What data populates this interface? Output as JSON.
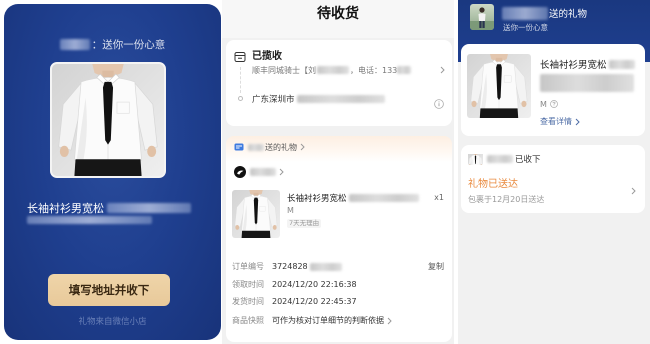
{
  "invite": {
    "greeting_suffix": "：送你一份心意",
    "product_name": "长袖衬衫男宽松",
    "accept_button_label": "填写地址并收下",
    "footer": "礼物来自微信小店"
  },
  "order_page": {
    "title": "待收货",
    "logistics": {
      "status": "已揽收",
      "courier_prefix": "顺丰同城骑士【刘",
      "phone_prefix": "，电话：133",
      "address_prefix": "广东深圳市"
    },
    "gift": {
      "header_suffix": "送的礼物",
      "product_name": "长袖衬衫男宽松",
      "quantity": "x1",
      "size": "M",
      "return_tag": "7天无理由",
      "copy_label": "复制",
      "rows": [
        {
          "label": "订单编号",
          "value": "3724828"
        },
        {
          "label": "领取时间",
          "value": "2024/12/20 22:16:38"
        },
        {
          "label": "发货时间",
          "value": "2024/12/20 22:45:37"
        },
        {
          "label": "商品快照",
          "value": "可作为核对订单细节的判断依据"
        }
      ]
    }
  },
  "gift_detail": {
    "header_title_suffix": "送的礼物",
    "header_subtitle": "送你一份心意",
    "product_name": "长袖衬衫男宽松",
    "size": "M",
    "details_link": "查看详情",
    "receiver_status": "已收下",
    "delivery_status": "礼物已送达",
    "delivery_note": "包裹于12月20日送达"
  },
  "icons": {
    "logistics": "package-icon",
    "address": "route-dot-icon",
    "info": "info-icon",
    "gift_source": "gift-card-icon",
    "shop": "shop-logo-icon",
    "size_help": "help-circle-icon",
    "navigate": "chevron-right-icon"
  },
  "colors": {
    "brand_navy": "#1f3f8f",
    "button_gold": "#e8c99a",
    "delivered_orange": "#e98a3e",
    "link_blue": "#4d6ca6"
  }
}
